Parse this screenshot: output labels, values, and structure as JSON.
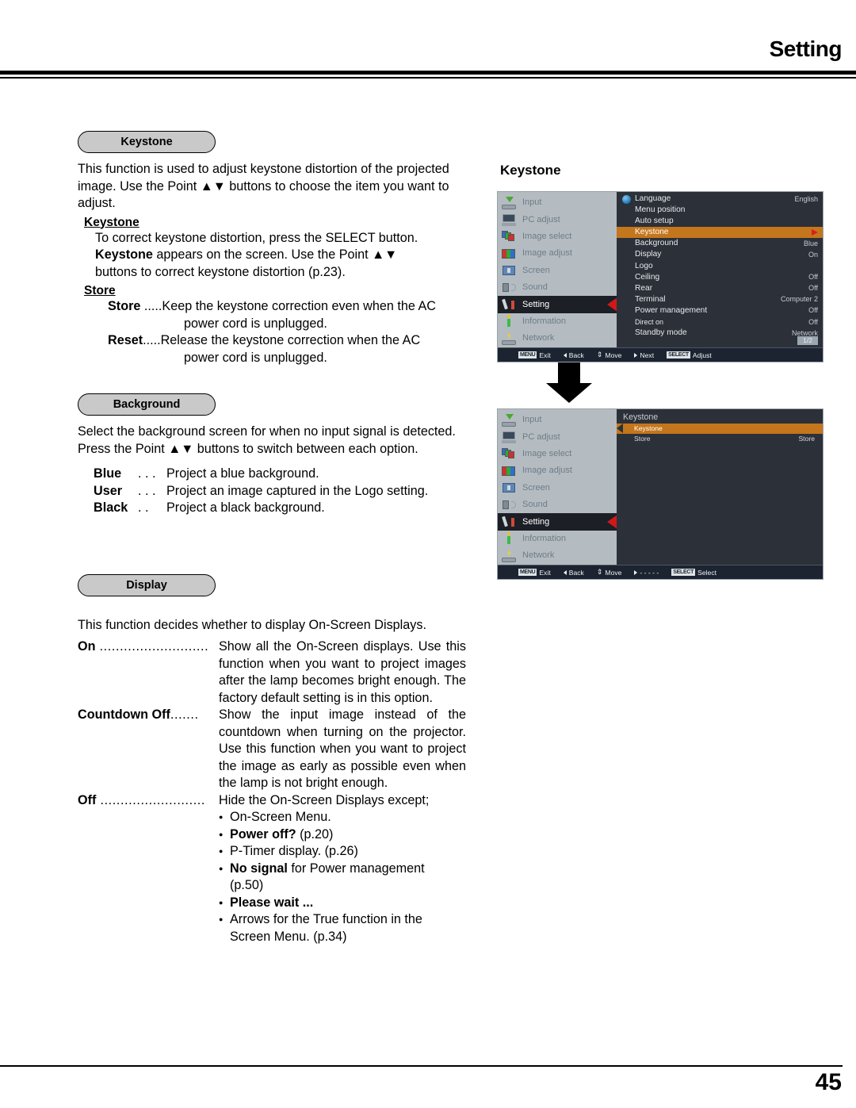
{
  "header": {
    "title": "Setting"
  },
  "footer": {
    "page_number": "45"
  },
  "sections": {
    "keystone": {
      "pill": "Keystone",
      "intro": "This function is used to adjust keystone distortion of the projected image. Use the Point ▲▼ buttons to choose the item you want to adjust.",
      "sub1_head": "Keystone",
      "sub1_line1": "To correct keystone distortion, press the SELECT button.",
      "sub1_bold": "Keystone",
      "sub1_line2_rest": " appears on the screen. Use the Point ▲▼",
      "sub1_line3": "buttons to correct keystone distortion (p.23).",
      "sub2_head": "Store",
      "store_term": "Store",
      "store_dots": " .....",
      "store_desc1": "Keep the keystone correction even when the AC",
      "store_desc2": "power cord is unplugged.",
      "reset_term": "Reset",
      "reset_dots": ".....",
      "reset_desc1": "Release the keystone correction when the AC",
      "reset_desc2": "power cord is unplugged."
    },
    "background": {
      "pill": "Background",
      "intro": "Select the background screen for when no input signal is detected. Press the Point ▲▼ buttons to switch between each option.",
      "options": [
        {
          "term": "Blue",
          "dots": ". . .",
          "desc": "Project a blue background."
        },
        {
          "term": "User",
          "dots": ". . .",
          "desc": "Project an image captured in the Logo setting."
        },
        {
          "term": "Black",
          "dots": ". .",
          "desc": "Project a black background."
        }
      ]
    },
    "display": {
      "pill": "Display",
      "intro": "This function decides whether to display On-Screen Displays.",
      "on_term": "On",
      "on_dots": " ...........................",
      "on_desc": "Show all the On-Screen displays. Use this function when you want to project images after the lamp becomes bright enough. The factory default setting is in this option.",
      "countdown_term": "Countdown Off",
      "countdown_dots": ".......",
      "countdown_desc": "Show the input image instead of the countdown when turning on the projector. Use this function when you want to project the image as early as possible even when the lamp is not bright enough.",
      "off_term": "Off",
      "off_dots": " ..........................",
      "off_desc": "Hide the On-Screen Displays except;",
      "off_bullets": [
        {
          "bold": "",
          "text": "On-Screen Menu."
        },
        {
          "bold": "Power off?",
          "text": " (p.20)"
        },
        {
          "bold": "",
          "text": "P-Timer display. (p.26)"
        },
        {
          "bold": "No signal",
          "text": " for Power management",
          "cont": "(p.50)"
        },
        {
          "bold": "Please wait ...",
          "text": ""
        },
        {
          "bold": "",
          "text": "Arrows for the True function in the",
          "cont": "Screen Menu. (p.34)"
        }
      ]
    }
  },
  "osd": {
    "caption": "Keystone",
    "sidebar_items": [
      {
        "label": "Input",
        "icon": "input-icon",
        "selected": false
      },
      {
        "label": "PC adjust",
        "icon": "pc-adjust-icon",
        "selected": false
      },
      {
        "label": "Image select",
        "icon": "image-select-icon",
        "selected": false
      },
      {
        "label": "Image adjust",
        "icon": "image-adjust-icon",
        "selected": false
      },
      {
        "label": "Screen",
        "icon": "screen-icon",
        "selected": false
      },
      {
        "label": "Sound",
        "icon": "sound-icon",
        "selected": false
      },
      {
        "label": "Setting",
        "icon": "setting-icon",
        "selected": true
      },
      {
        "label": "Information",
        "icon": "information-icon",
        "selected": false
      },
      {
        "label": "Network",
        "icon": "network-icon",
        "selected": false
      }
    ],
    "screen1": {
      "rows": [
        {
          "label": "Language",
          "value": "English",
          "highlighted": false,
          "has_globe": true,
          "arrow": false
        },
        {
          "label": "Menu position",
          "value": "",
          "highlighted": false,
          "has_globe": false,
          "arrow": false
        },
        {
          "label": "Auto setup",
          "value": "",
          "highlighted": false,
          "has_globe": false,
          "arrow": false
        },
        {
          "label": "Keystone",
          "value": "",
          "highlighted": true,
          "has_globe": false,
          "arrow": true
        },
        {
          "label": "Background",
          "value": "Blue",
          "highlighted": false,
          "has_globe": false,
          "arrow": false
        },
        {
          "label": "Display",
          "value": "On",
          "highlighted": false,
          "has_globe": false,
          "arrow": false
        },
        {
          "label": "Logo",
          "value": "",
          "highlighted": false,
          "has_globe": false,
          "arrow": false
        },
        {
          "label": "Ceiling",
          "value": "Off",
          "highlighted": false,
          "has_globe": false,
          "arrow": false
        },
        {
          "label": "Rear",
          "value": "Off",
          "highlighted": false,
          "has_globe": false,
          "arrow": false
        },
        {
          "label": "Terminal",
          "value": "Computer 2",
          "highlighted": false,
          "has_globe": false,
          "arrow": false
        },
        {
          "label": "Power management",
          "value": "Off",
          "highlighted": false,
          "has_globe": false,
          "arrow": false
        },
        {
          "label": "Direct on",
          "value": "Off",
          "highlighted": false,
          "has_globe": false,
          "arrow": false
        },
        {
          "label": "Standby mode",
          "value": "Network",
          "highlighted": false,
          "has_globe": false,
          "arrow": false
        }
      ],
      "page_badge": "1/2",
      "footer": [
        {
          "key": "MENU",
          "label": "Exit",
          "marker": "key"
        },
        {
          "key": "",
          "label": "Back",
          "marker": "tri-l"
        },
        {
          "key": "",
          "label": "Move",
          "marker": "updown"
        },
        {
          "key": "",
          "label": "Next",
          "marker": "tri-r"
        },
        {
          "key": "SELECT",
          "label": "Adjust",
          "marker": "key"
        }
      ]
    },
    "screen2": {
      "title": "Keystone",
      "rows": [
        {
          "label": "Keystone",
          "value": "",
          "highlighted": true
        },
        {
          "label": "Store",
          "value": "Store",
          "highlighted": false
        }
      ],
      "footer": [
        {
          "key": "MENU",
          "label": "Exit",
          "marker": "key"
        },
        {
          "key": "",
          "label": "Back",
          "marker": "tri-l"
        },
        {
          "key": "",
          "label": "Move",
          "marker": "updown"
        },
        {
          "key": "",
          "label": "- - - - -",
          "marker": "tri-r"
        },
        {
          "key": "SELECT",
          "label": "Select",
          "marker": "key"
        }
      ]
    }
  },
  "colors": {
    "highlight_orange": "#c4761c",
    "sidebar_gray": "#b4bcc2",
    "osd_dark": "#2b3039",
    "pill_gray": "#c9c9c9",
    "red_arrow": "#d01818"
  }
}
